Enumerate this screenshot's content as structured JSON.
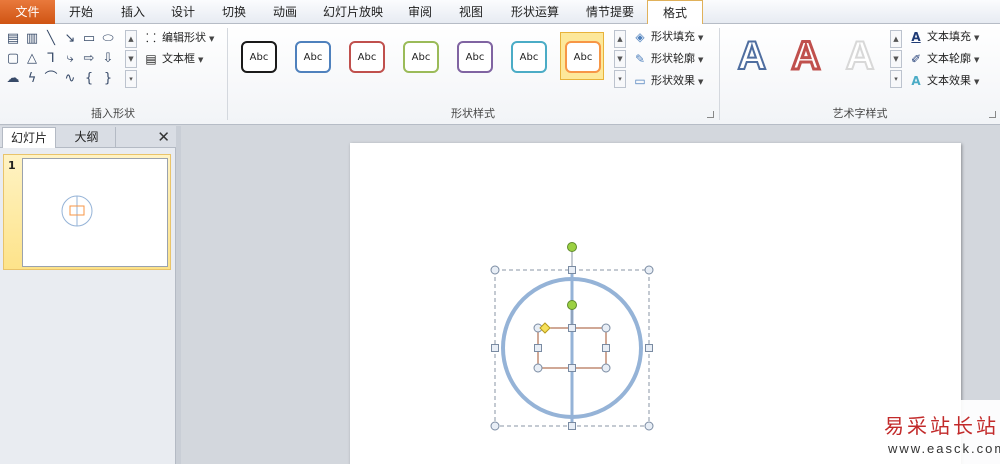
{
  "tabs": [
    {
      "label": "文件"
    },
    {
      "label": "开始"
    },
    {
      "label": "插入"
    },
    {
      "label": "设计"
    },
    {
      "label": "切换"
    },
    {
      "label": "动画"
    },
    {
      "label": "幻灯片放映"
    },
    {
      "label": "审阅"
    },
    {
      "label": "视图"
    },
    {
      "label": "形状运算"
    },
    {
      "label": "情节提要"
    },
    {
      "label": "格式"
    }
  ],
  "active_tab": "格式",
  "groups": {
    "insert_shapes": {
      "label": "插入形状",
      "edit_shape": "编辑形状",
      "text_box": "文本框"
    },
    "shape_styles": {
      "label": "形状样式",
      "sample": "Abc",
      "fill": "形状填充",
      "outline": "形状轮廓",
      "effects": "形状效果"
    },
    "wordart": {
      "label": "艺术字样式",
      "sample": "A",
      "fill": "文本填充",
      "outline": "文本轮廓",
      "effects": "文本效果"
    }
  },
  "colors": {
    "style_borders": [
      "#1a1a1a",
      "#4f81bd",
      "#c0504d",
      "#9bbb59",
      "#8064a2",
      "#4bacc6",
      "#f79646"
    ],
    "accent": "#f79646",
    "file_tab": "#d35d1c",
    "circle": "#95b3d7"
  },
  "pane": {
    "tab_slides": "幻灯片",
    "tab_outline": "大纲",
    "close": "✕",
    "slide_number": "1"
  },
  "watermark": {
    "line1": "易采站长站",
    "line2": "www.easck.com"
  }
}
